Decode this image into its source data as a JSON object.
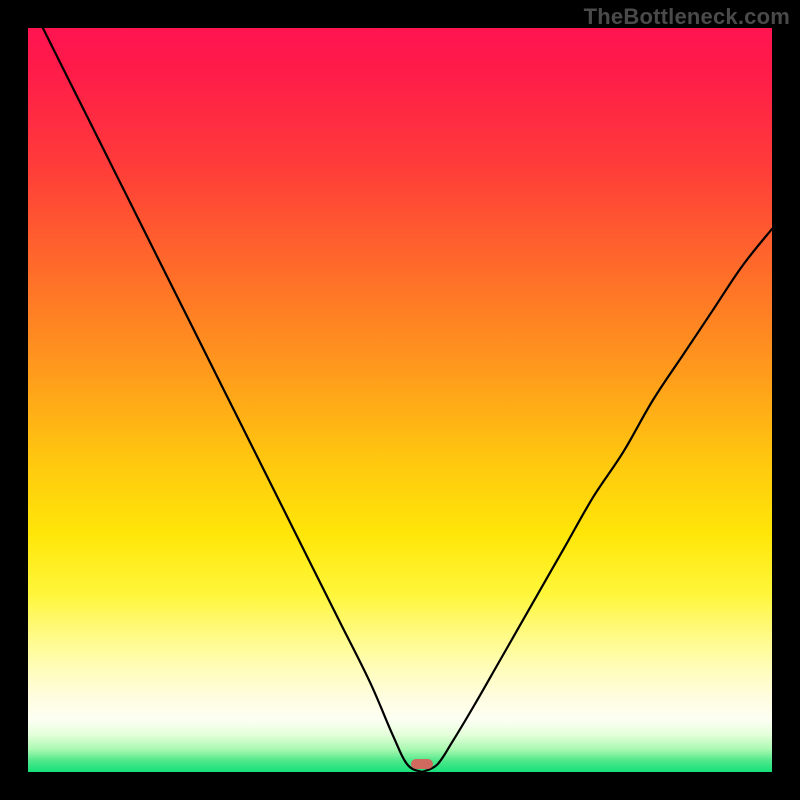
{
  "watermark": "TheBottleneck.com",
  "colors": {
    "background": "#000000",
    "gradient_top": "#ff1450",
    "gradient_mid": "#ffe608",
    "gradient_bottom": "#16e07a",
    "curve": "#000000",
    "minimum_marker": "#d06a5e",
    "watermark_text": "#4a4a4a"
  },
  "chart_data": {
    "type": "line",
    "title": "",
    "xlabel": "",
    "ylabel": "",
    "xlim": [
      0,
      1
    ],
    "ylim": [
      0,
      1
    ],
    "minimum_x": 0.53,
    "curve_points": [
      {
        "x": 0.02,
        "y": 1.0
      },
      {
        "x": 0.06,
        "y": 0.92
      },
      {
        "x": 0.1,
        "y": 0.84
      },
      {
        "x": 0.14,
        "y": 0.76
      },
      {
        "x": 0.18,
        "y": 0.68
      },
      {
        "x": 0.22,
        "y": 0.6
      },
      {
        "x": 0.26,
        "y": 0.52
      },
      {
        "x": 0.3,
        "y": 0.44
      },
      {
        "x": 0.34,
        "y": 0.36
      },
      {
        "x": 0.38,
        "y": 0.28
      },
      {
        "x": 0.42,
        "y": 0.2
      },
      {
        "x": 0.46,
        "y": 0.12
      },
      {
        "x": 0.49,
        "y": 0.05
      },
      {
        "x": 0.51,
        "y": 0.01
      },
      {
        "x": 0.53,
        "y": 0.0
      },
      {
        "x": 0.55,
        "y": 0.01
      },
      {
        "x": 0.57,
        "y": 0.04
      },
      {
        "x": 0.6,
        "y": 0.09
      },
      {
        "x": 0.64,
        "y": 0.16
      },
      {
        "x": 0.68,
        "y": 0.23
      },
      {
        "x": 0.72,
        "y": 0.3
      },
      {
        "x": 0.76,
        "y": 0.37
      },
      {
        "x": 0.8,
        "y": 0.43
      },
      {
        "x": 0.84,
        "y": 0.5
      },
      {
        "x": 0.88,
        "y": 0.56
      },
      {
        "x": 0.92,
        "y": 0.62
      },
      {
        "x": 0.96,
        "y": 0.68
      },
      {
        "x": 1.0,
        "y": 0.73
      }
    ],
    "annotations": []
  }
}
